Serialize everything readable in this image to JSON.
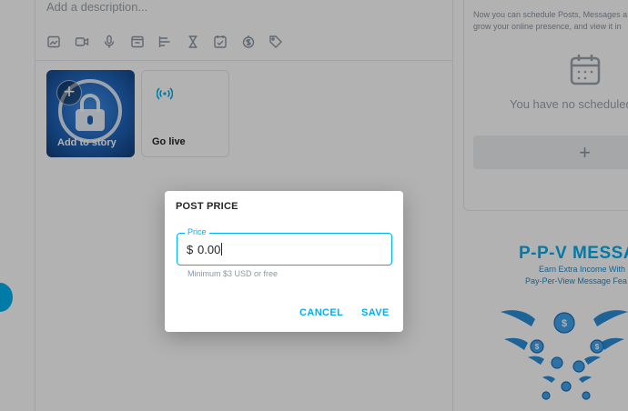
{
  "composer": {
    "description_placeholder": "Add a description...",
    "toolbar_icons": [
      "image-icon",
      "video-icon",
      "microphone-icon",
      "gif-icon",
      "poll-icon",
      "hourglass-icon",
      "checklist-icon",
      "price-tag-dollar-icon",
      "tag-icon"
    ]
  },
  "stories": {
    "add_label": "Add to story",
    "live_label": "Go live"
  },
  "schedule": {
    "intro_line1": "Now you can schedule Posts, Messages a",
    "intro_line2": "grow your online presence, and view it in",
    "empty_text": "You have no scheduled",
    "add_symbol": "+"
  },
  "promo": {
    "title": "P-P-V MESSAG",
    "line1": "Earn Extra Income With",
    "line2": "Pay-Per-View Message Fea"
  },
  "dialog": {
    "title": "POST PRICE",
    "field_label": "Price",
    "currency_symbol": "$",
    "value": "0.00",
    "helper": "Minimum $3 USD or free",
    "cancel_label": "CANCEL",
    "save_label": "SAVE"
  },
  "colors": {
    "accent": "#00aff0",
    "text_dark": "#242529",
    "text_muted": "#8a96a3"
  }
}
